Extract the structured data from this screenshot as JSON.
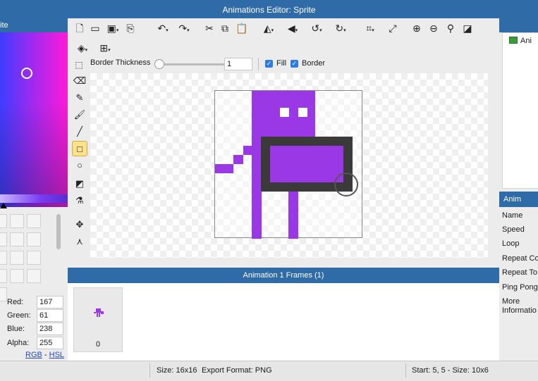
{
  "window": {
    "title": "Animations Editor: Sprite"
  },
  "left_panel": {
    "header": "ite",
    "color": {
      "red": "167",
      "green": "61",
      "blue": "238",
      "alpha": "255"
    },
    "labels": {
      "red": "Red:",
      "green": "Green:",
      "blue": "Blue:",
      "alpha": "Alpha:"
    },
    "mode_rgb": "RGB",
    "mode_sep": "-",
    "mode_hsl": "HSL"
  },
  "toolbar": {
    "border_thickness_label": "Border Thickness",
    "border_thickness_value": "1",
    "fill_label": "Fill",
    "border_label": "Border"
  },
  "sprite_colors": {
    "purple": "#9b38e6",
    "border": "#3a3a3a"
  },
  "frames_panel": {
    "title": "Animation 1 Frames (1)",
    "frames": [
      {
        "index": "0"
      }
    ]
  },
  "right_panel": {
    "animation_item": "Ani",
    "properties_header": "Anim",
    "properties": [
      "Name",
      "Speed",
      "Loop",
      "Repeat Co",
      "Repeat To",
      "Ping Pong",
      "More",
      "Informatio"
    ]
  },
  "status": {
    "size": "Size: 16x16",
    "export_format": "Export Format: PNG",
    "selection": "Start: 5, 5 - Size: 10x6"
  }
}
